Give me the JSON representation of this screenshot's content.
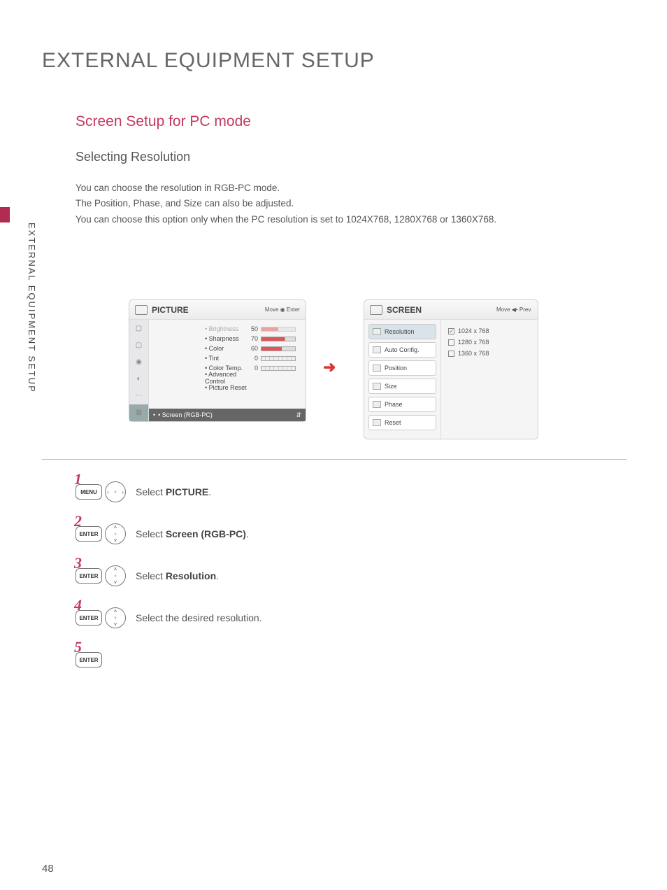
{
  "sideLabel": "EXTERNAL EQUIPMENT SETUP",
  "pageTitle": "EXTERNAL EQUIPMENT SETUP",
  "subtitle": "Screen Setup for PC mode",
  "sectionHeading": "Selecting Resolution",
  "body": {
    "l1": "You can choose the resolution in RGB-PC mode.",
    "l2": "The Position, Phase, and Size can also be adjusted.",
    "l3": "You can choose this option only when the PC resolution is set to 1024X768, 1280X768 or 1360X768."
  },
  "osdLeft": {
    "title": "PICTURE",
    "nav": "Move   ◉ Enter",
    "items": [
      {
        "label": "• Brightness",
        "value": "50",
        "fill": "50%",
        "dim": true
      },
      {
        "label": "• Sharpness",
        "value": "70",
        "fill": "70%"
      },
      {
        "label": "• Color",
        "value": "60",
        "fill": "60%"
      },
      {
        "label": "• Tint",
        "value": "0",
        "special": "rg"
      },
      {
        "label": "• Color Temp.",
        "value": "0",
        "special": "wc"
      },
      {
        "label": "• Advanced Control",
        "nobar": true
      },
      {
        "label": "• Picture Reset",
        "nobar": true
      }
    ],
    "highlight": "• Screen (RGB-PC)"
  },
  "osdRight": {
    "title": "SCREEN",
    "nav": "Move   ◀• Prev.",
    "menu": [
      {
        "label": "Resolution",
        "sel": true
      },
      {
        "label": "Auto Config."
      },
      {
        "label": "Position"
      },
      {
        "label": "Size"
      },
      {
        "label": "Phase"
      },
      {
        "label": "Reset"
      }
    ],
    "options": [
      {
        "label": "1024 x 768",
        "checked": true
      },
      {
        "label": "1280 x 768",
        "checked": false
      },
      {
        "label": "1360 x 768",
        "checked": false
      }
    ]
  },
  "steps": {
    "s1": {
      "num": "1",
      "btn": "MENU",
      "text": "Select ",
      "bold": "PICTURE",
      "after": "."
    },
    "s2": {
      "num": "2",
      "btn": "ENTER",
      "text": "Select ",
      "bold": "Screen (RGB-PC)",
      "after": "."
    },
    "s3": {
      "num": "3",
      "btn": "ENTER",
      "text": "Select ",
      "bold": "Resolution",
      "after": "."
    },
    "s4": {
      "num": "4",
      "btn": "ENTER",
      "text": "Select the desired resolution.",
      "bold": "",
      "after": ""
    },
    "s5": {
      "num": "5",
      "btn": "ENTER"
    }
  },
  "pageNumber": "48"
}
